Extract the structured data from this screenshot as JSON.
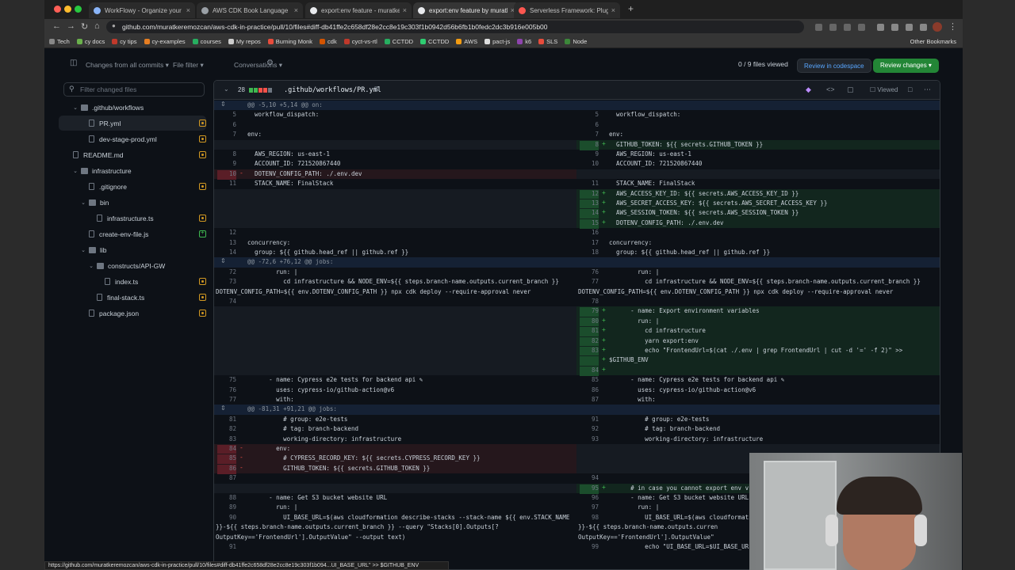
{
  "browser": {
    "tabs": [
      {
        "title": "WorkFlowy - Organize your br",
        "fav": "#8ab4f8"
      },
      {
        "title": "AWS CDK Book Language",
        "fav": "#9aa0a6"
      },
      {
        "title": "export:env feature - muratke",
        "fav": "#e8eaed"
      },
      {
        "title": "export:env feature by muratk",
        "fav": "#e8eaed"
      },
      {
        "title": "Serverless Framework: Plugins",
        "fav": "#fd5750"
      }
    ],
    "url": "github.com/muratkeremozcan/aws-cdk-in-practice/pull/10/files#diff-db41ffe2c658df28e2cc8e19c303f1b0942d56b6fb1b0fedc2dc3b916e005b00",
    "bookmarks": [
      "Tech",
      "cy docs",
      "cy tips",
      "cy-examples",
      "courses",
      "My repos",
      "Burning Monk",
      "cdk",
      "cyct-vs-rtl",
      "CCTDD",
      "CCTDD",
      "AWS",
      "pact-js",
      "k6",
      "SLS",
      "Node"
    ],
    "other_bookmarks": "Other Bookmarks",
    "status_url": "https://github.com/muratkeremozcan/aws-cdk-in-practice/pull/10/files#diff-db41ffe2c658df28e2cc8e19c303f1b094...UI_BASE_URL\" >> $GITHUB_ENV"
  },
  "toolbar": {
    "changes": "Changes from all commits",
    "file_filter": "File filter",
    "conversations": "Conversations",
    "viewed_count": "0 / 9 files viewed",
    "codespace": "Review in codespace",
    "review": "Review changes"
  },
  "sidebar": {
    "filter_placeholder": "Filter changed files",
    "items": [
      {
        "label": ".github/workflows",
        "kind": "dir",
        "indent": 1,
        "status": ""
      },
      {
        "label": "PR.yml",
        "kind": "file",
        "indent": 2,
        "status": "mod",
        "selected": true
      },
      {
        "label": "dev-stage-prod.yml",
        "kind": "file",
        "indent": 2,
        "status": "mod"
      },
      {
        "label": "README.md",
        "kind": "file",
        "indent": 0,
        "status": "mod"
      },
      {
        "label": "infrastructure",
        "kind": "dir",
        "indent": 1,
        "status": ""
      },
      {
        "label": ".gitignore",
        "kind": "file",
        "indent": 2,
        "status": "mod"
      },
      {
        "label": "bin",
        "kind": "dir",
        "indent": 2,
        "status": ""
      },
      {
        "label": "infrastructure.ts",
        "kind": "file",
        "indent": 3,
        "status": "mod"
      },
      {
        "label": "create-env-file.js",
        "kind": "file",
        "indent": 2,
        "status": "add"
      },
      {
        "label": "lib",
        "kind": "dir",
        "indent": 2,
        "status": ""
      },
      {
        "label": "constructs/API-GW",
        "kind": "dir",
        "indent": 3,
        "status": ""
      },
      {
        "label": "index.ts",
        "kind": "file",
        "indent": 4,
        "status": "mod"
      },
      {
        "label": "final-stack.ts",
        "kind": "file",
        "indent": 3,
        "status": "mod"
      },
      {
        "label": "package.json",
        "kind": "file",
        "indent": 2,
        "status": "mod"
      }
    ]
  },
  "diff": {
    "changes_count": "28",
    "file_path": ".github/workflows/PR.yml",
    "viewed_label": "Viewed",
    "rows": [
      {
        "t": "hunk",
        "text": "@@ -5,10 +5,14 @@ on:"
      },
      {
        "l": {
          "n": "5",
          "c": "  workflow_dispatch:"
        },
        "r": {
          "n": "5",
          "c": "  workflow_dispatch:"
        }
      },
      {
        "l": {
          "n": "6",
          "c": ""
        },
        "r": {
          "n": "6",
          "c": ""
        }
      },
      {
        "l": {
          "n": "7",
          "c": "env:"
        },
        "r": {
          "n": "7",
          "c": "env:"
        }
      },
      {
        "l": {
          "e": true
        },
        "r": {
          "n": "8",
          "s": "+",
          "c": "  GITHUB_TOKEN: ${{ secrets.GITHUB_TOKEN }}"
        }
      },
      {
        "l": {
          "n": "8",
          "c": "  AWS_REGION: us-east-1"
        },
        "r": {
          "n": "9",
          "c": "  AWS_REGION: us-east-1"
        }
      },
      {
        "l": {
          "n": "9",
          "c": "  ACCOUNT_ID: 721520867440"
        },
        "r": {
          "n": "10",
          "c": "  ACCOUNT_ID: 721520867440"
        }
      },
      {
        "l": {
          "n": "10",
          "s": "-",
          "c": "  DOTENV_CONFIG_PATH: ./.env.dev"
        },
        "r": {
          "e": true
        }
      },
      {
        "l": {
          "n": "11",
          "c": "  STACK_NAME: FinalStack"
        },
        "r": {
          "n": "11",
          "c": "  STACK_NAME: FinalStack"
        }
      },
      {
        "l": {
          "e": true
        },
        "r": {
          "n": "12",
          "s": "+",
          "c": "  AWS_ACCESS_KEY_ID: ${{ secrets.AWS_ACCESS_KEY_ID }}"
        }
      },
      {
        "l": {
          "e": true
        },
        "r": {
          "n": "13",
          "s": "+",
          "c": "  AWS_SECRET_ACCESS_KEY: ${{ secrets.AWS_SECRET_ACCESS_KEY }}"
        }
      },
      {
        "l": {
          "e": true
        },
        "r": {
          "n": "14",
          "s": "+",
          "c": "  AWS_SESSION_TOKEN: ${{ secrets.AWS_SESSION_TOKEN }}"
        }
      },
      {
        "l": {
          "e": true
        },
        "r": {
          "n": "15",
          "s": "+",
          "c": "  DOTENV_CONFIG_PATH: ./.env.dev"
        }
      },
      {
        "l": {
          "n": "12",
          "c": ""
        },
        "r": {
          "n": "16",
          "c": ""
        }
      },
      {
        "l": {
          "n": "13",
          "c": "concurrency:"
        },
        "r": {
          "n": "17",
          "c": "concurrency:"
        }
      },
      {
        "l": {
          "n": "14",
          "c": "  group: ${{ github.head_ref || github.ref }}"
        },
        "r": {
          "n": "18",
          "c": "  group: ${{ github.head_ref || github.ref }}"
        }
      },
      {
        "t": "hunk",
        "text": "@@ -72,6 +76,12 @@ jobs:"
      },
      {
        "l": {
          "n": "72",
          "c": "        run: |"
        },
        "r": {
          "n": "76",
          "c": "        run: |"
        }
      },
      {
        "l": {
          "n": "73",
          "c": "          cd infrastructure && NODE_ENV=${{ steps.branch-name.outputs.current_branch }}"
        },
        "r": {
          "n": "77",
          "c": "          cd infrastructure && NODE_ENV=${{ steps.branch-name.outputs.current_branch }}"
        }
      },
      {
        "l": {
          "c": "DOTENV_CONFIG_PATH=${{ env.DOTENV_CONFIG_PATH }} npx cdk deploy --require-approval never"
        },
        "r": {
          "c": "DOTENV_CONFIG_PATH=${{ env.DOTENV_CONFIG_PATH }} npx cdk deploy --require-approval never"
        }
      },
      {
        "l": {
          "n": "74",
          "c": ""
        },
        "r": {
          "n": "78",
          "c": ""
        }
      },
      {
        "l": {
          "e": true
        },
        "r": {
          "n": "79",
          "s": "+",
          "c": "      - name: Export environment variables"
        }
      },
      {
        "l": {
          "e": true
        },
        "r": {
          "n": "80",
          "s": "+",
          "c": "        run: |"
        }
      },
      {
        "l": {
          "e": true
        },
        "r": {
          "n": "81",
          "s": "+",
          "c": "          cd infrastructure"
        }
      },
      {
        "l": {
          "e": true
        },
        "r": {
          "n": "82",
          "s": "+",
          "c": "          yarn export:env"
        }
      },
      {
        "l": {
          "e": true
        },
        "r": {
          "n": "83",
          "s": "+",
          "c": "          echo \"FrontendUrl=$(cat ./.env | grep FrontendUrl | cut -d '=' -f 2)\" >>"
        }
      },
      {
        "l": {
          "e": true
        },
        "r": {
          "s": "+",
          "c": "$GITHUB_ENV",
          "cont": true
        }
      },
      {
        "l": {
          "e": true
        },
        "r": {
          "n": "84",
          "s": "+",
          "c": ""
        }
      },
      {
        "l": {
          "n": "75",
          "c": "      - name: Cypress e2e tests for backend api ✎"
        },
        "r": {
          "n": "85",
          "c": "      - name: Cypress e2e tests for backend api ✎"
        }
      },
      {
        "l": {
          "n": "76",
          "c": "        uses: cypress-io/github-action@v6"
        },
        "r": {
          "n": "86",
          "c": "        uses: cypress-io/github-action@v6"
        }
      },
      {
        "l": {
          "n": "77",
          "c": "        with:"
        },
        "r": {
          "n": "87",
          "c": "        with:"
        }
      },
      {
        "t": "hunk",
        "text": "@@ -81,31 +91,21 @@ jobs:"
      },
      {
        "l": {
          "n": "81",
          "c": "          # group: e2e-tests"
        },
        "r": {
          "n": "91",
          "c": "          # group: e2e-tests"
        }
      },
      {
        "l": {
          "n": "82",
          "c": "          # tag: branch-backend"
        },
        "r": {
          "n": "92",
          "c": "          # tag: branch-backend"
        }
      },
      {
        "l": {
          "n": "83",
          "c": "          working-directory: infrastructure"
        },
        "r": {
          "n": "93",
          "c": "          working-directory: infrastructure"
        }
      },
      {
        "l": {
          "n": "84",
          "s": "-",
          "c": "        env:"
        },
        "r": {
          "e": true
        }
      },
      {
        "l": {
          "n": "85",
          "s": "-",
          "c": "          # CYPRESS_RECORD_KEY: ${{ secrets.CYPRESS_RECORD_KEY }}"
        },
        "r": {
          "e": true
        }
      },
      {
        "l": {
          "n": "86",
          "s": "-",
          "c": "          GITHUB_TOKEN: ${{ secrets.GITHUB_TOKEN }}"
        },
        "r": {
          "e": true
        }
      },
      {
        "l": {
          "n": "87",
          "c": ""
        },
        "r": {
          "n": "94",
          "c": ""
        }
      },
      {
        "l": {
          "e": true
        },
        "r": {
          "n": "95",
          "s": "+",
          "c": "      # in case you cannot export env v"
        }
      },
      {
        "l": {
          "n": "88",
          "c": "      - name: Get S3 bucket website URL"
        },
        "r": {
          "n": "96",
          "c": "      - name: Get S3 bucket website URL"
        }
      },
      {
        "l": {
          "n": "89",
          "c": "        run: |"
        },
        "r": {
          "n": "97",
          "c": "        run: |"
        }
      },
      {
        "l": {
          "n": "90",
          "c": "          UI_BASE_URL=$(aws cloudformation describe-stacks --stack-name ${{ env.STACK_NAME"
        },
        "r": {
          "n": "98",
          "c": "          UI_BASE_URL=$(aws cloudformation"
        }
      },
      {
        "l": {
          "c": "}}-${{ steps.branch-name.outputs.current_branch }} --query \"Stacks[0].Outputs[?"
        },
        "r": {
          "c": "}}-${{ steps.branch-name.outputs.curren"
        }
      },
      {
        "l": {
          "c": "OutputKey=='FrontendUrl'].OutputValue\" --output text)"
        },
        "r": {
          "c": "OutputKey=='FrontendUrl'].OutputValue\""
        }
      },
      {
        "l": {
          "n": "91",
          "c": ""
        },
        "r": {
          "n": "99",
          "c": "          echo \"UI_BASE_URL=$UI_BASE_UR"
        }
      }
    ]
  }
}
